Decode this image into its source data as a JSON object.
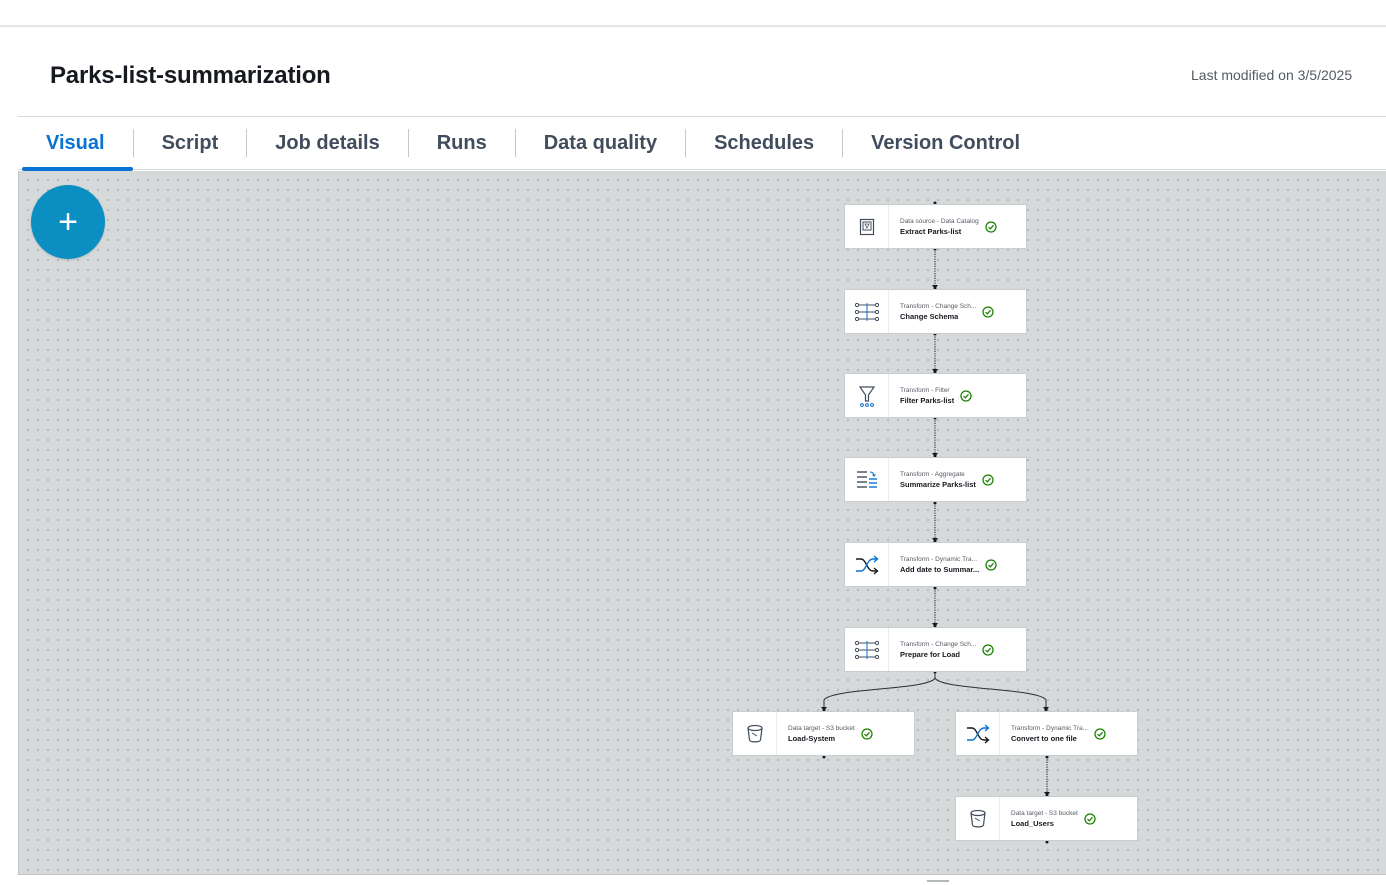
{
  "job": {
    "title": "Parks-list-summarization",
    "last_modified": "Last modified on 3/5/2025"
  },
  "tabs": [
    {
      "label": "Visual",
      "active": true
    },
    {
      "label": "Script",
      "active": false
    },
    {
      "label": "Job details",
      "active": false
    },
    {
      "label": "Runs",
      "active": false
    },
    {
      "label": "Data quality",
      "active": false
    },
    {
      "label": "Schedules",
      "active": false
    },
    {
      "label": "Version Control",
      "active": false
    }
  ],
  "canvas": {
    "add_button_label": "+",
    "nodes": [
      {
        "type": "Data source - Data Catalog",
        "name": "Extract Parks-list",
        "icon": "catalog-icon",
        "status": "success"
      },
      {
        "type": "Transform - Change Sch...",
        "name": "Change Schema",
        "icon": "change-schema-icon",
        "status": "success"
      },
      {
        "type": "Transform - Filter",
        "name": "Filter Parks-list",
        "icon": "filter-icon",
        "status": "success"
      },
      {
        "type": "Transform - Aggregate",
        "name": "Summarize Parks-list",
        "icon": "aggregate-icon",
        "status": "success"
      },
      {
        "type": "Transform - Dynamic Tra...",
        "name": "Add date to Summar...",
        "icon": "shuffle-icon",
        "status": "success"
      },
      {
        "type": "Transform - Change Sch...",
        "name": "Prepare for Load",
        "icon": "change-schema-icon",
        "status": "success"
      },
      {
        "type": "Data target - S3 bucket",
        "name": "Load-System",
        "icon": "s3-bucket-icon",
        "status": "success"
      },
      {
        "type": "Transform - Dynamic Tra...",
        "name": "Convert to one file",
        "icon": "shuffle-icon",
        "status": "success"
      },
      {
        "type": "Data target - S3 bucket",
        "name": "Load_Users",
        "icon": "s3-bucket-icon",
        "status": "success"
      }
    ]
  },
  "colors": {
    "accent": "#0972d3",
    "add_button": "#0b8fc2",
    "success": "#1d8102",
    "canvas": "#d5d9da"
  }
}
